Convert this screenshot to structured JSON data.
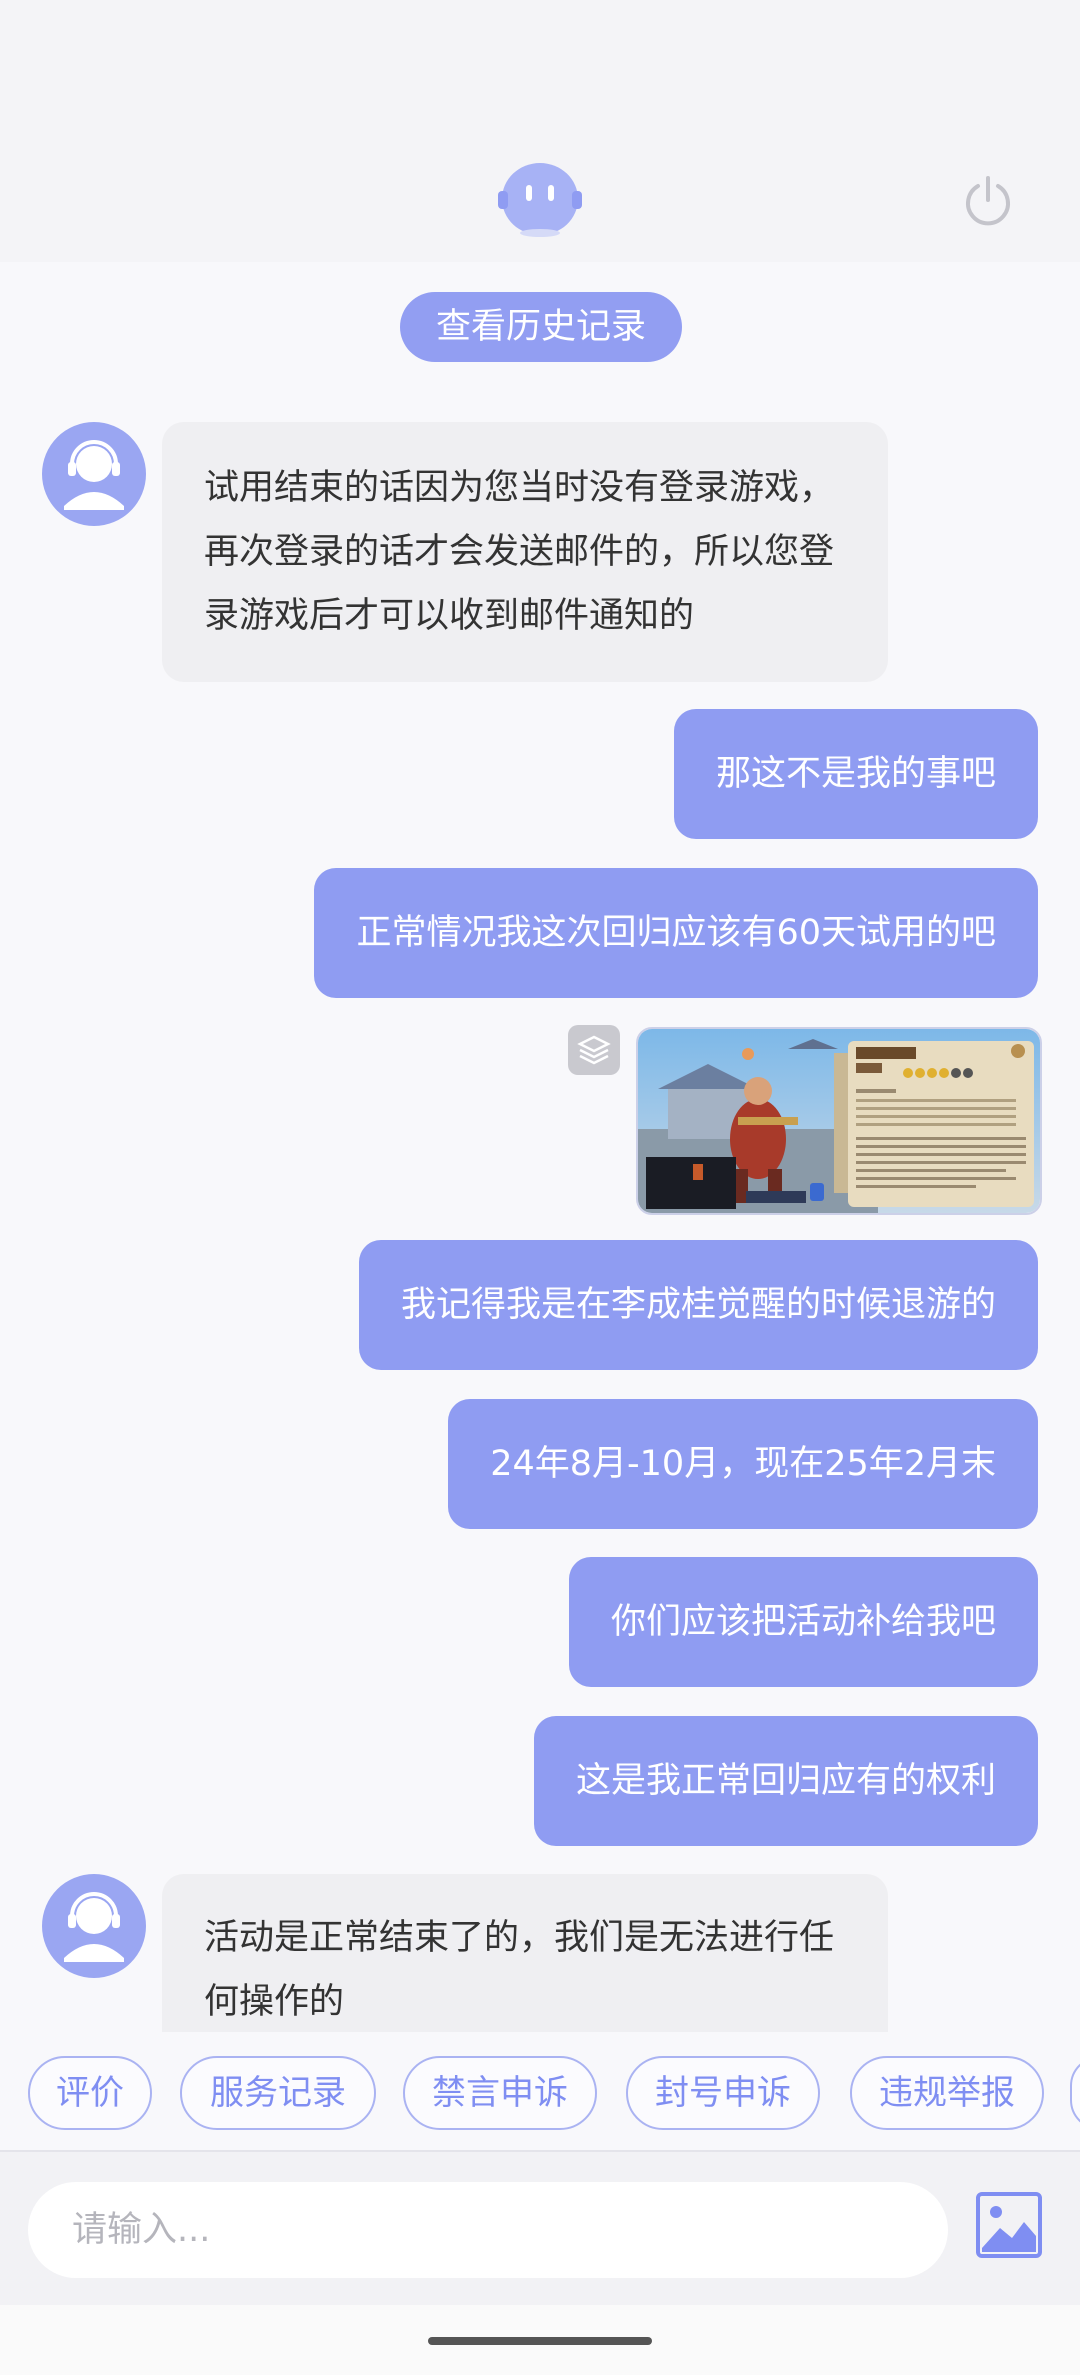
{
  "history_button": "查看历史记录",
  "messages": [
    {
      "side": "left",
      "text": "试用结束的话因为您当时没有登录游戏，再次登录的话才会发送邮件的，所以您登录游戏后才可以收到邮件通知的"
    },
    {
      "side": "right",
      "text": "那这不是我的事吧"
    },
    {
      "side": "right",
      "text": "正常情况我这次回归应该有60天试用的吧"
    },
    {
      "side": "right",
      "type": "image",
      "icon": "game-screenshot"
    },
    {
      "side": "right",
      "text": "我记得我是在李成桂觉醒的时候退游的"
    },
    {
      "side": "right",
      "text": "24年8月-10月，现在25年2月末"
    },
    {
      "side": "right",
      "text": "你们应该把活动补给我吧"
    },
    {
      "side": "right",
      "text": "这是我正常回归应有的权利"
    },
    {
      "side": "left",
      "text": "活动是正常结束了的，我们是无法进行任何操作的"
    }
  ],
  "quick_actions": [
    "评价",
    "服务记录",
    "禁言申诉",
    "封号申诉",
    "违规举报"
  ],
  "input": {
    "placeholder": "请输入..."
  },
  "icons": {
    "header": "bot-avatar-icon",
    "power": "power-icon",
    "agent": "support-agent-avatar",
    "image": "image-upload-icon",
    "layers": "layers-icon"
  },
  "colors": {
    "accent": "#8f9cf2",
    "bubble_left": "#efeff2",
    "chip_text": "#7f8ef2"
  }
}
